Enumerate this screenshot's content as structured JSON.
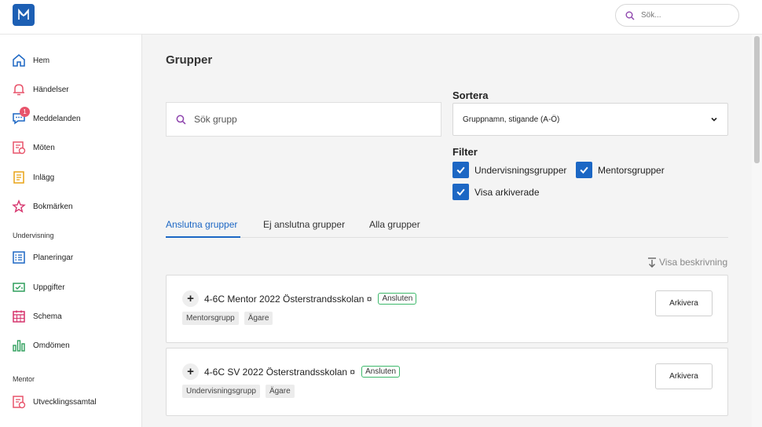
{
  "colors": {
    "accent": "#1c67c4",
    "brand": "#1c5fb4",
    "badge": "#e8546b",
    "status_border": "#3cb86a"
  },
  "top_search": {
    "placeholder": "Sök..."
  },
  "sidebar": {
    "items": [
      {
        "label": "Hem",
        "icon": "home-icon"
      },
      {
        "label": "Händelser",
        "icon": "bell-icon"
      },
      {
        "label": "Meddelanden",
        "icon": "chat-icon",
        "badge": "1"
      },
      {
        "label": "Möten",
        "icon": "meeting-icon"
      },
      {
        "label": "Inlägg",
        "icon": "post-icon"
      },
      {
        "label": "Bokmärken",
        "icon": "star-icon"
      }
    ],
    "section_undervisning": "Undervisning",
    "undervisning_items": [
      {
        "label": "Planeringar",
        "icon": "planning-icon"
      },
      {
        "label": "Uppgifter",
        "icon": "assignment-icon"
      },
      {
        "label": "Schema",
        "icon": "calendar-icon"
      },
      {
        "label": "Omdömen",
        "icon": "bar-chart-icon"
      }
    ],
    "section_mentor": "Mentor",
    "mentor_items": [
      {
        "label": "Utvecklingssamtal",
        "icon": "meeting-icon"
      }
    ]
  },
  "main": {
    "title": "Grupper",
    "group_search": {
      "placeholder": "Sök grupp"
    },
    "sort": {
      "label": "Sortera",
      "selected": "Gruppnamn, stigande (A-Ö)"
    },
    "filter": {
      "label": "Filter",
      "options": [
        {
          "label": "Undervisningsgrupper",
          "checked": true
        },
        {
          "label": "Mentorsgrupper",
          "checked": true
        },
        {
          "label": "Visa arkiverade",
          "checked": true
        }
      ]
    },
    "tabs": [
      {
        "label": "Anslutna grupper",
        "active": true
      },
      {
        "label": "Ej anslutna grupper",
        "active": false
      },
      {
        "label": "Alla grupper",
        "active": false
      }
    ],
    "show_description": "Visa beskrivning",
    "groups": [
      {
        "name": "4-6C Mentor  2022 Österstrandsskolan ¤",
        "status": "Ansluten",
        "tags": [
          "Mentorsgrupp",
          "Ägare"
        ],
        "action": "Arkivera"
      },
      {
        "name": "4-6C  SV  2022 Österstrandsskolan ¤",
        "status": "Ansluten",
        "tags": [
          "Undervisningsgrupp",
          "Ägare"
        ],
        "action": "Arkivera"
      }
    ]
  }
}
